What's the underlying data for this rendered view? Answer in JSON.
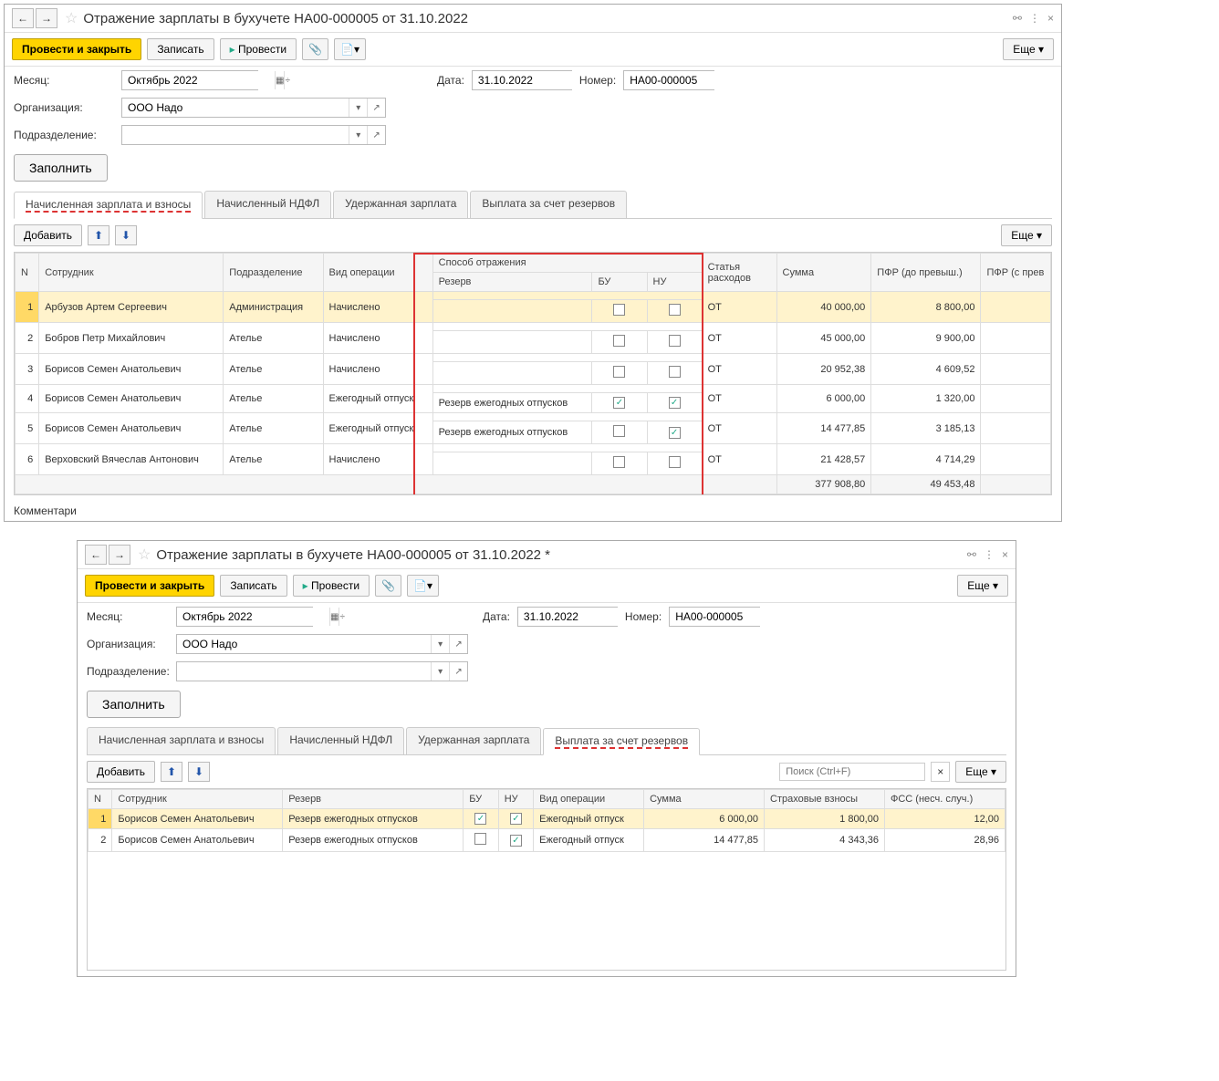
{
  "win1": {
    "title": "Отражение зарплаты в бухучете НА00-000005 от 31.10.2022",
    "toolbar": {
      "post_close": "Провести и закрыть",
      "write": "Записать",
      "post": "Провести",
      "more": "Еще"
    },
    "fields": {
      "month_lbl": "Месяц:",
      "month_val": "Октябрь 2022",
      "date_lbl": "Дата:",
      "date_val": "31.10.2022",
      "number_lbl": "Номер:",
      "number_val": "НА00-000005",
      "org_lbl": "Организация:",
      "org_val": "ООО Надо",
      "dept_lbl": "Подразделение:",
      "dept_val": ""
    },
    "fill_btn": "Заполнить",
    "tabs": [
      "Начисленная зарплата и взносы",
      "Начисленный НДФЛ",
      "Удержанная зарплата",
      "Выплата за счет резервов"
    ],
    "tab2": {
      "add": "Добавить",
      "more": "Еще"
    },
    "cols": {
      "n": "N",
      "emp": "Сотрудник",
      "dept": "Подразделение",
      "op": "Вид операции",
      "refl": "Способ отражения",
      "reserve": "Резерв",
      "bu": "БУ",
      "nu": "НУ",
      "cost": "Статья расходов",
      "sum": "Сумма",
      "pfr_below": "ПФР (до превыш.)",
      "pfr_above": "ПФР (с прев"
    },
    "rows": [
      {
        "n": "1",
        "emp": "Арбузов Артем Сергеевич",
        "dept": "Администрация",
        "op": "Начислено",
        "reserve": "",
        "bu": false,
        "nu": false,
        "cost": "ОТ",
        "sum": "40 000,00",
        "pfr": "8 800,00"
      },
      {
        "n": "2",
        "emp": "Бобров Петр Михайлович",
        "dept": "Ателье",
        "op": "Начислено",
        "reserve": "",
        "bu": false,
        "nu": false,
        "cost": "ОТ",
        "sum": "45 000,00",
        "pfr": "9 900,00"
      },
      {
        "n": "3",
        "emp": "Борисов Семен Анатольевич",
        "dept": "Ателье",
        "op": "Начислено",
        "reserve": "",
        "bu": false,
        "nu": false,
        "cost": "ОТ",
        "sum": "20 952,38",
        "pfr": "4 609,52"
      },
      {
        "n": "4",
        "emp": "Борисов Семен Анатольевич",
        "dept": "Ателье",
        "op": "Ежегодный отпуск",
        "reserve": "Резерв ежегодных отпусков",
        "bu": true,
        "nu": true,
        "cost": "ОТ",
        "sum": "6 000,00",
        "pfr": "1 320,00"
      },
      {
        "n": "5",
        "emp": "Борисов Семен Анатольевич",
        "dept": "Ателье",
        "op": "Ежегодный отпуск",
        "reserve": "Резерв ежегодных отпусков",
        "bu": false,
        "nu": true,
        "cost": "ОТ",
        "sum": "14 477,85",
        "pfr": "3 185,13"
      },
      {
        "n": "6",
        "emp": "Верховский Вячеслав Антонович",
        "dept": "Ателье",
        "op": "Начислено",
        "reserve": "",
        "bu": false,
        "nu": false,
        "cost": "ОТ",
        "sum": "21 428,57",
        "pfr": "4 714,29"
      }
    ],
    "totals": {
      "sum": "377 908,80",
      "pfr": "49 453,48"
    },
    "comment_lbl": "Комментари"
  },
  "win2": {
    "title": "Отражение зарплаты в бухучете НА00-000005 от 31.10.2022 *",
    "toolbar": {
      "post_close": "Провести и закрыть",
      "write": "Записать",
      "post": "Провести",
      "more": "Еще"
    },
    "fields": {
      "month_lbl": "Месяц:",
      "month_val": "Октябрь 2022",
      "date_lbl": "Дата:",
      "date_val": "31.10.2022",
      "number_lbl": "Номер:",
      "number_val": "НА00-000005",
      "org_lbl": "Организация:",
      "org_val": "ООО Надо",
      "dept_lbl": "Подразделение:",
      "dept_val": ""
    },
    "fill_btn": "Заполнить",
    "tabs": [
      "Начисленная зарплата и взносы",
      "Начисленный НДФЛ",
      "Удержанная зарплата",
      "Выплата за счет резервов"
    ],
    "tab2": {
      "add": "Добавить",
      "more": "Еще",
      "search_ph": "Поиск (Ctrl+F)"
    },
    "cols": {
      "n": "N",
      "emp": "Сотрудник",
      "reserve": "Резерв",
      "bu": "БУ",
      "nu": "НУ",
      "op": "Вид операции",
      "sum": "Сумма",
      "ins": "Страховые взносы",
      "fss": "ФСС (несч. случ.)"
    },
    "rows": [
      {
        "n": "1",
        "emp": "Борисов Семен Анатольевич",
        "reserve": "Резерв ежегодных отпусков",
        "bu": true,
        "nu": true,
        "op": "Ежегодный отпуск",
        "sum": "6 000,00",
        "ins": "1 800,00",
        "fss": "12,00"
      },
      {
        "n": "2",
        "emp": "Борисов Семен Анатольевич",
        "reserve": "Резерв ежегодных отпусков",
        "bu": false,
        "nu": true,
        "op": "Ежегодный отпуск",
        "sum": "14 477,85",
        "ins": "4 343,36",
        "fss": "28,96"
      }
    ]
  }
}
